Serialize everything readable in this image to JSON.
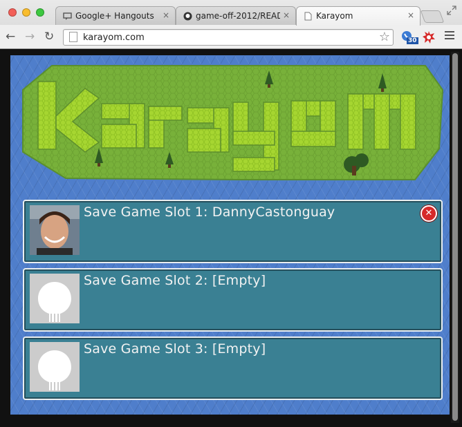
{
  "browser": {
    "tabs": [
      {
        "title": "Google+ Hangouts",
        "icon": "hangouts-icon"
      },
      {
        "title": "game-off-2012/READM",
        "icon": "github-icon"
      },
      {
        "title": "Karayom",
        "icon": "page-icon"
      }
    ],
    "close_glyph": "×",
    "back_glyph": "←",
    "forward_glyph": "→",
    "reload_glyph": "↻",
    "star_glyph": "☆",
    "url": "karayom.com",
    "extension_badge": "30"
  },
  "game": {
    "logo_text": "Karayom",
    "slots": [
      {
        "title": "Save Game Slot 1: DannyCastonguay",
        "avatar": "user-photo",
        "deletable": true
      },
      {
        "title": "Save Game Slot 2: [Empty]",
        "avatar": "github-octocat"
      },
      {
        "title": "Save Game Slot 3: [Empty]",
        "avatar": "github-octocat"
      }
    ],
    "delete_glyph": "✕"
  },
  "colors": {
    "water": "#4f7ecb",
    "grass": "#7bb23c",
    "slot_bg": "#3a8093",
    "logo_letters": "#a6d631"
  }
}
